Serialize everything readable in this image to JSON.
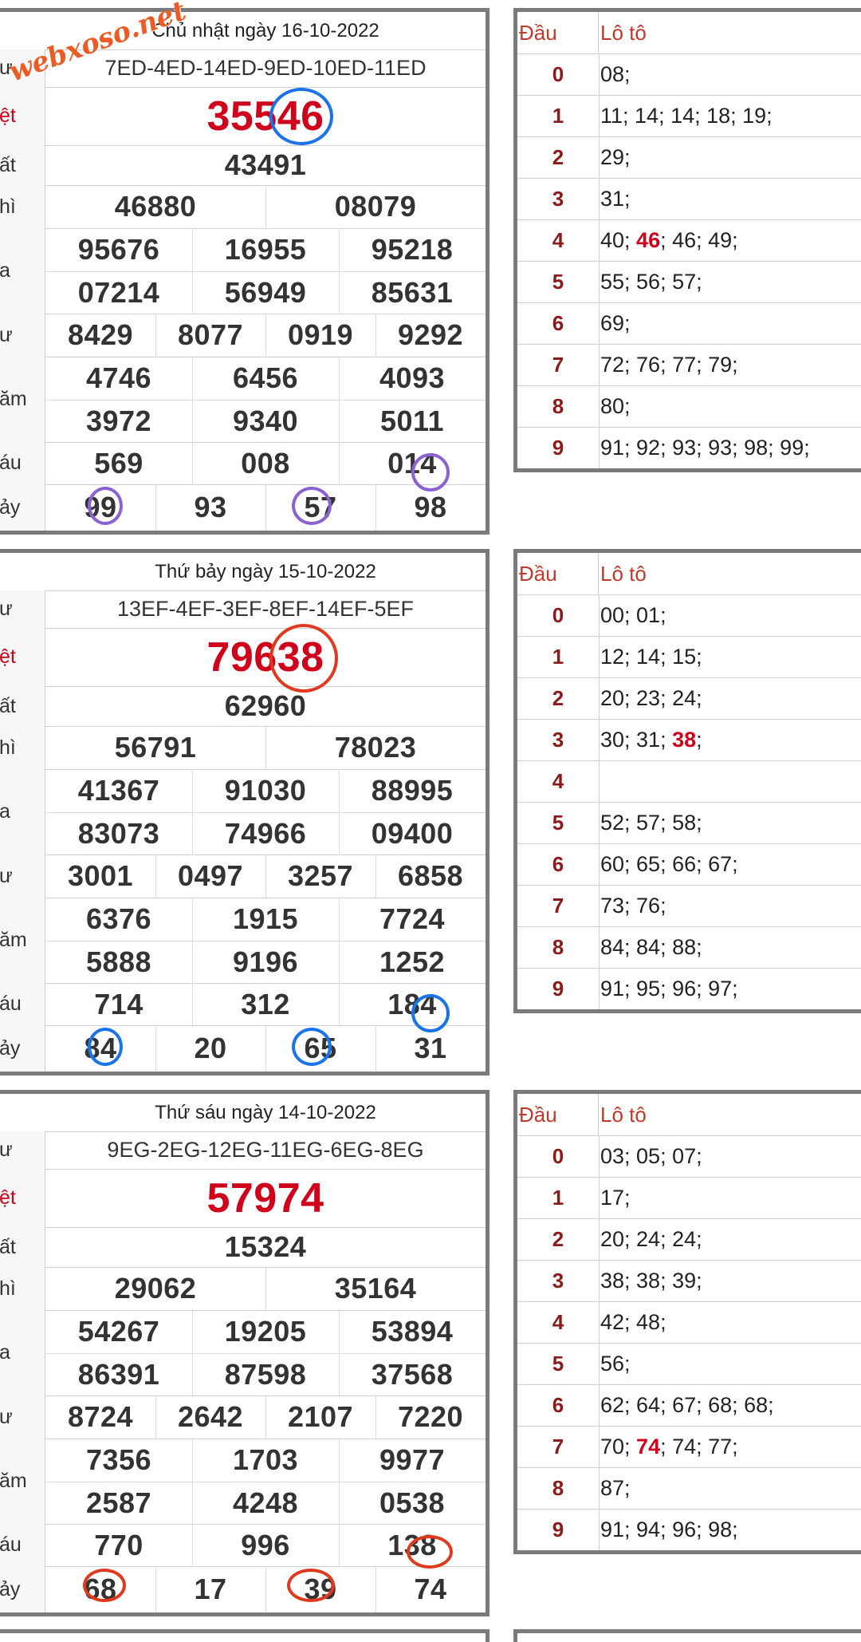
{
  "watermark": "webxoso.net",
  "results": [
    {
      "title": "Chủ nhật ngày 16-10-2022",
      "code": "7ED-4ED-14ED-9ED-10ED-11ED",
      "labels": {
        "code": "ư",
        "db": "ệt",
        "g1": "ất",
        "g2": "hì",
        "g3": "a",
        "g4": "ư",
        "g5": "ăm",
        "g6": "áu",
        "g7": "ảy"
      },
      "db": "35546",
      "g1": "43491",
      "g2": [
        "46880",
        "08079"
      ],
      "g3": [
        "95676",
        "16955",
        "95218",
        "07214",
        "56949",
        "85631"
      ],
      "g4": [
        "8429",
        "8077",
        "0919",
        "9292"
      ],
      "g5": [
        "4746",
        "6456",
        "4093",
        "3972",
        "9340",
        "5011"
      ],
      "g6": [
        "569",
        "008",
        "014"
      ],
      "g7": [
        "99",
        "93",
        "57",
        "98"
      ]
    },
    {
      "title": "Thứ bảy ngày 15-10-2022",
      "code": "13EF-4EF-3EF-8EF-14EF-5EF",
      "labels": {
        "code": "ư",
        "db": "ệt",
        "g1": "ất",
        "g2": "hì",
        "g3": "a",
        "g4": "ư",
        "g5": "ăm",
        "g6": "áu",
        "g7": "ảy"
      },
      "db": "79638",
      "g1": "62960",
      "g2": [
        "56791",
        "78023"
      ],
      "g3": [
        "41367",
        "91030",
        "88995",
        "83073",
        "74966",
        "09400"
      ],
      "g4": [
        "3001",
        "0497",
        "3257",
        "6858"
      ],
      "g5": [
        "6376",
        "1915",
        "7724",
        "5888",
        "9196",
        "1252"
      ],
      "g6": [
        "714",
        "312",
        "184"
      ],
      "g7": [
        "84",
        "20",
        "65",
        "31"
      ]
    },
    {
      "title": "Thứ sáu ngày 14-10-2022",
      "code": "9EG-2EG-12EG-11EG-6EG-8EG",
      "labels": {
        "code": "ư",
        "db": "ệt",
        "g1": "ất",
        "g2": "hì",
        "g3": "a",
        "g4": "ư",
        "g5": "ăm",
        "g6": "áu",
        "g7": "ảy"
      },
      "db": "57974",
      "g1": "15324",
      "g2": [
        "29062",
        "35164"
      ],
      "g3": [
        "54267",
        "19205",
        "53894",
        "86391",
        "87598",
        "37568"
      ],
      "g4": [
        "8724",
        "2642",
        "2107",
        "7220"
      ],
      "g5": [
        "7356",
        "1703",
        "9977",
        "2587",
        "4248",
        "0538"
      ],
      "g6": [
        "770",
        "996",
        "138"
      ],
      "g7": [
        "68",
        "17",
        "39",
        "74"
      ]
    }
  ],
  "loto": [
    {
      "head": [
        "Đầu",
        "Lô tô"
      ],
      "rows": [
        {
          "d": "0",
          "pre": "08;",
          "hl": "",
          "post": ""
        },
        {
          "d": "1",
          "pre": "11; 14; 14; 18; 19;",
          "hl": "",
          "post": ""
        },
        {
          "d": "2",
          "pre": "29;",
          "hl": "",
          "post": ""
        },
        {
          "d": "3",
          "pre": "31;",
          "hl": "",
          "post": ""
        },
        {
          "d": "4",
          "pre": "40; ",
          "hl": "46",
          "post": "; 46; 49;"
        },
        {
          "d": "5",
          "pre": "55; 56; 57;",
          "hl": "",
          "post": ""
        },
        {
          "d": "6",
          "pre": "69;",
          "hl": "",
          "post": ""
        },
        {
          "d": "7",
          "pre": "72; 76; 77; 79;",
          "hl": "",
          "post": ""
        },
        {
          "d": "8",
          "pre": "80;",
          "hl": "",
          "post": ""
        },
        {
          "d": "9",
          "pre": "91; 92; 93; 93; 98; 99;",
          "hl": "",
          "post": ""
        }
      ]
    },
    {
      "head": [
        "Đầu",
        "Lô tô"
      ],
      "rows": [
        {
          "d": "0",
          "pre": "00; 01;",
          "hl": "",
          "post": ""
        },
        {
          "d": "1",
          "pre": "12; 14; 15;",
          "hl": "",
          "post": ""
        },
        {
          "d": "2",
          "pre": "20; 23; 24;",
          "hl": "",
          "post": ""
        },
        {
          "d": "3",
          "pre": "30; 31; ",
          "hl": "38",
          "post": ";"
        },
        {
          "d": "4",
          "pre": "",
          "hl": "",
          "post": ""
        },
        {
          "d": "5",
          "pre": "52; 57; 58;",
          "hl": "",
          "post": ""
        },
        {
          "d": "6",
          "pre": "60; 65; 66; 67;",
          "hl": "",
          "post": ""
        },
        {
          "d": "7",
          "pre": "73; 76;",
          "hl": "",
          "post": ""
        },
        {
          "d": "8",
          "pre": "84; 84; 88;",
          "hl": "",
          "post": ""
        },
        {
          "d": "9",
          "pre": "91; 95; 96; 97;",
          "hl": "",
          "post": ""
        }
      ]
    },
    {
      "head": [
        "Đầu",
        "Lô tô"
      ],
      "rows": [
        {
          "d": "0",
          "pre": "03; 05; 07;",
          "hl": "",
          "post": ""
        },
        {
          "d": "1",
          "pre": "17;",
          "hl": "",
          "post": ""
        },
        {
          "d": "2",
          "pre": "20; 24; 24;",
          "hl": "",
          "post": ""
        },
        {
          "d": "3",
          "pre": "38; 38; 39;",
          "hl": "",
          "post": ""
        },
        {
          "d": "4",
          "pre": "42; 48;",
          "hl": "",
          "post": ""
        },
        {
          "d": "5",
          "pre": "56;",
          "hl": "",
          "post": ""
        },
        {
          "d": "6",
          "pre": "62; 64; 67; 68; 68;",
          "hl": "",
          "post": ""
        },
        {
          "d": "7",
          "pre": "70; ",
          "hl": "74",
          "post": "; 74; 77;"
        },
        {
          "d": "8",
          "pre": "87;",
          "hl": "",
          "post": ""
        },
        {
          "d": "9",
          "pre": "91; 94; 96; 98;",
          "hl": "",
          "post": ""
        }
      ]
    }
  ],
  "ring_colors": [
    "#8a63d2",
    "#1a73e8",
    "#e03a1e"
  ],
  "db_ring_colors": [
    "#1a73e8",
    "#e03a1e",
    ""
  ]
}
